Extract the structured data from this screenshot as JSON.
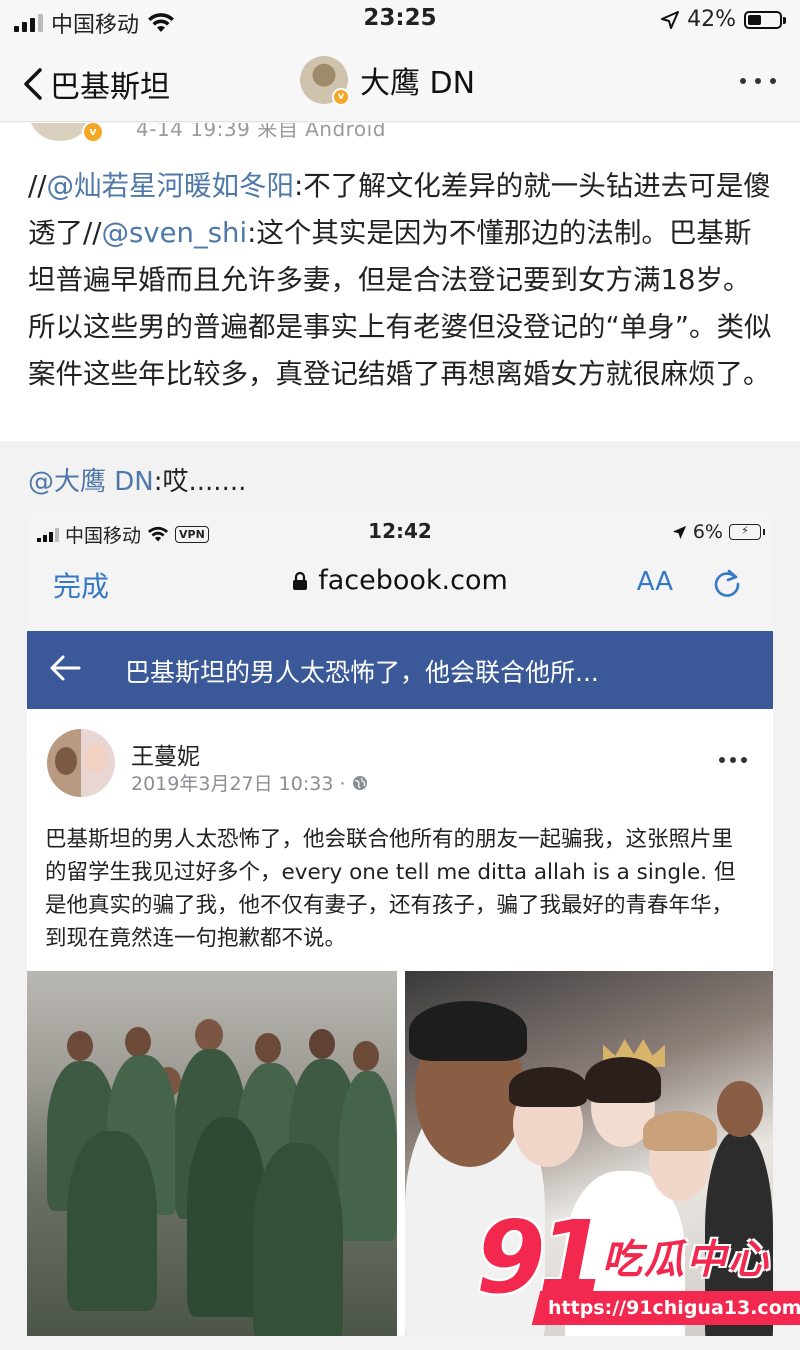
{
  "status_bar": {
    "carrier": "中国移动",
    "time": "23:25",
    "battery": "42%"
  },
  "nav": {
    "back_label": "巴基斯坦",
    "title": "大鹰 DN"
  },
  "previous_post": {
    "meta": "4-14 19:39  来自 Android"
  },
  "post": {
    "prefix": "//",
    "mention1": "@灿若星河暖如冬阳",
    "text1": ":不了解文化差异的就一头钻进去可是傻透了//",
    "mention2": "@sven_shi",
    "text2": ":这个其实是因为不懂那边的法制。巴基斯坦普遍早婚而且允许多妻，但是合法登记要到女方满18岁。所以这些男的普遍都是事实上有老婆但没登记的“单身”。类似案件这些年比较多，真登记结婚了再想离婚女方就很麻烦了。"
  },
  "retweet": {
    "mention": "@大鹰 DN",
    "text": ":哎......."
  },
  "screenshot": {
    "status": {
      "carrier": "中国移动",
      "vpn": "VPN",
      "time": "12:42",
      "battery": "6%"
    },
    "browser": {
      "done_label": "完成",
      "url": "facebook.com",
      "text_size_label": "AA"
    },
    "fb_header": {
      "title": "巴基斯坦的男人太恐怖了，他会联合他所..."
    },
    "fb_post": {
      "author": "王蔓妮",
      "date": "2019年3月27日 10:33 ·",
      "text": "巴基斯坦的男人太恐怖了，他会联合他所有的朋友一起骗我，这张照片里的留学生我见过好多个，every one tell me ditta allah is a single. 但是他真实的骗了我，他不仅有妻子，还有孩子，骗了我最好的青春年华，到现在竟然连一句抱歉都不说。"
    }
  },
  "watermark": {
    "brand_number": "91",
    "brand_text": "吃瓜中心",
    "url": "https://91chigua13.com"
  },
  "colors": {
    "link": "#4e78a8",
    "ios_blue": "#3478c6",
    "facebook_blue": "#3b5998",
    "watermark_red": "#f2284e"
  },
  "icons": [
    "signal-icon",
    "wifi-icon",
    "location-arrow-icon",
    "battery-icon",
    "chevron-left-icon",
    "more-icon",
    "lock-icon",
    "reload-icon",
    "back-arrow-icon",
    "globe-icon"
  ]
}
